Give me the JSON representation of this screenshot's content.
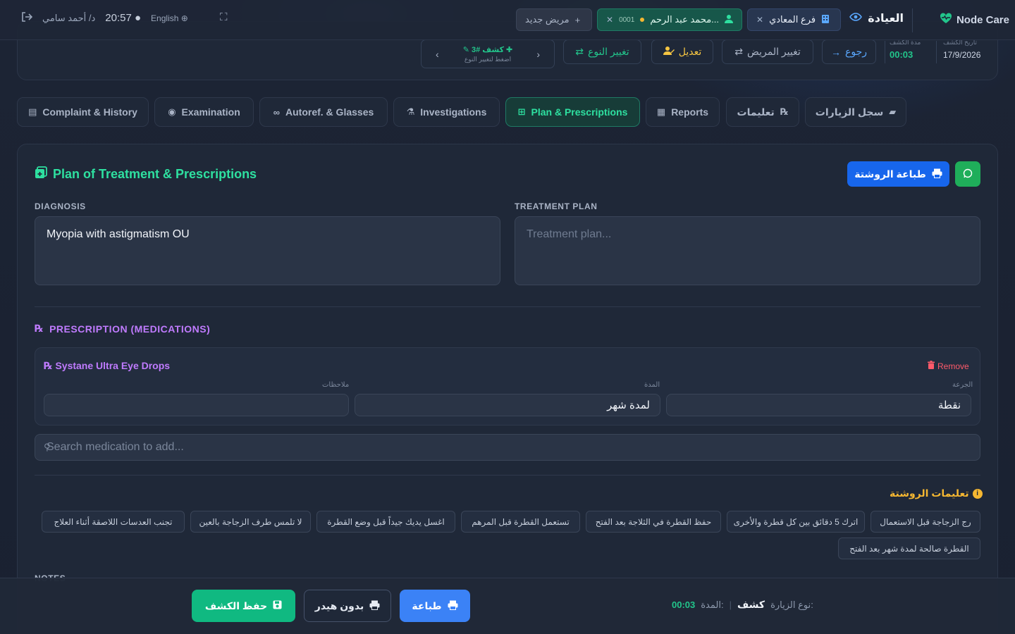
{
  "topbar": {
    "brand": "Node Care",
    "clinic": "العيادة",
    "branch": "فرع المعادي",
    "patient_name": "محمد عبد الرحم...",
    "patient_code": "0001",
    "new_patient": "مريض جديد",
    "clock": "20:57",
    "user": "د/ أحمد سامي",
    "language": "English"
  },
  "header": {
    "back": "رجوع",
    "change_patient": "تغيير المريض",
    "edit": "تعديل",
    "change_type": "تغيير النوع",
    "visit_label": "كشف #3",
    "visit_hint": "اضغط لتغيير النوع",
    "duration_label": "مدة الكشف",
    "duration_value": "00:03",
    "date_label": "تاريخ الكشف",
    "date_value": "17/9/2026"
  },
  "tabs": [
    {
      "label": "Complaint & History",
      "icon": "clipboard-icon"
    },
    {
      "label": "Examination",
      "icon": "eye-icon"
    },
    {
      "label": "Autoref. & Glasses",
      "icon": "glasses-icon"
    },
    {
      "label": "Investigations",
      "icon": "microscope-icon"
    },
    {
      "label": "Plan & Prescriptions",
      "icon": "prescription-icon"
    },
    {
      "label": "Reports",
      "icon": "file-icon"
    },
    {
      "label": "تعليمات",
      "icon": "rx-icon"
    },
    {
      "label": "سجل الزيارات",
      "icon": "folder-icon"
    }
  ],
  "plan": {
    "title": "Plan of Treatment & Prescriptions",
    "print_rx": "طباعة الروشتة",
    "diagnosis_label": "DIAGNOSIS",
    "diagnosis_value": "Myopia with astigmatism OU",
    "treatment_label": "TREATMENT PLAN",
    "treatment_placeholder": "Treatment plan...",
    "rx_heading": "PRESCRIPTION (MEDICATIONS)",
    "medication": {
      "name": "Systane Ultra Eye Drops",
      "remove": "Remove",
      "dose_label": "الجرعة",
      "dose_value": "نقطة",
      "duration_label": "المدة",
      "duration_value": "لمدة شهر",
      "notes_label": "ملاحظات",
      "notes_value": ""
    },
    "search_placeholder": "Search medication to add...",
    "instructions_title": "تعليمات الروشتة",
    "instructions": [
      "رج الزجاجة قبل الاستعمال",
      "اترك 5 دقائق بين كل قطرة والأخرى",
      "حفظ القطرة في الثلاجة بعد الفتح",
      "تستعمل القطرة قبل المرهم",
      "اغسل يديك جيداً قبل وضع القطرة",
      "لا تلمس طرف الزجاجة بالعين",
      "تجنب العدسات اللاصقة أثناء العلاج",
      "القطرة صالحة لمدة شهر بعد الفتح"
    ],
    "notes_label": "NOTES"
  },
  "bottom": {
    "save": "حفظ الكشف",
    "no_header": "بدون هيدر",
    "print": "طباعة",
    "visit_type_label": "نوع الزيارة:",
    "visit_type_value": "كشف",
    "duration_label": "المدة:",
    "duration_value": "00:03"
  },
  "colors": {
    "accent_green": "#22c58b",
    "accent_blue": "#1766ec",
    "accent_purple": "#c07bff",
    "accent_amber": "#f5b731",
    "danger": "#ff5a6a"
  }
}
